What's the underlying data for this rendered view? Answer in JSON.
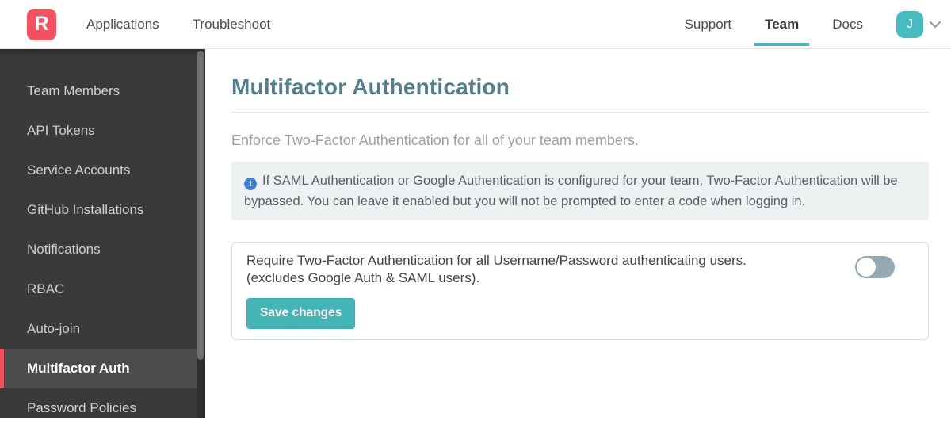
{
  "colors": {
    "brand_red": "#f4515e",
    "teal_accent": "#45b6b8",
    "tab_underline": "#4cb5b8",
    "avatar_bg": "#47bcc0",
    "heading": "#527e8e",
    "info_icon_blue": "#3c7fdb",
    "info_box_bg": "#eef1f2",
    "toggle_off": "#94aab2",
    "sidebar_bg": "#3a3a3a",
    "sidebar_active_bg": "#4b4b4b"
  },
  "navbar": {
    "logo_letter": "R",
    "left_items": [
      {
        "label": "Applications"
      },
      {
        "label": "Troubleshoot"
      }
    ],
    "right_items": [
      {
        "label": "Support",
        "active": false
      },
      {
        "label": "Team",
        "active": true
      },
      {
        "label": "Docs",
        "active": false
      }
    ],
    "avatar_initial": "J"
  },
  "sidebar": {
    "items": [
      {
        "label": "Team Members",
        "active": false
      },
      {
        "label": "API Tokens",
        "active": false
      },
      {
        "label": "Service Accounts",
        "active": false
      },
      {
        "label": "GitHub Installations",
        "active": false
      },
      {
        "label": "Notifications",
        "active": false
      },
      {
        "label": "RBAC",
        "active": false
      },
      {
        "label": "Auto-join",
        "active": false
      },
      {
        "label": "Multifactor Auth",
        "active": true
      },
      {
        "label": "Password Policies",
        "active": false
      }
    ]
  },
  "main": {
    "title": "Multifactor Authentication",
    "intro": "Enforce Two-Factor Authentication for all of your team members.",
    "info_icon_glyph": "i",
    "info_note": "If SAML Authentication or Google Authentication is configured for your team, Two-Factor Authentication will be bypassed. You can leave it enabled but you will not be prompted to enter a code when logging in.",
    "setting": {
      "label_line1": "Require Two-Factor Authentication for all Username/Password authenticating users.",
      "label_line2": "(excludes Google Auth & SAML users).",
      "toggle_state": "off",
      "save_label": "Save changes"
    }
  }
}
